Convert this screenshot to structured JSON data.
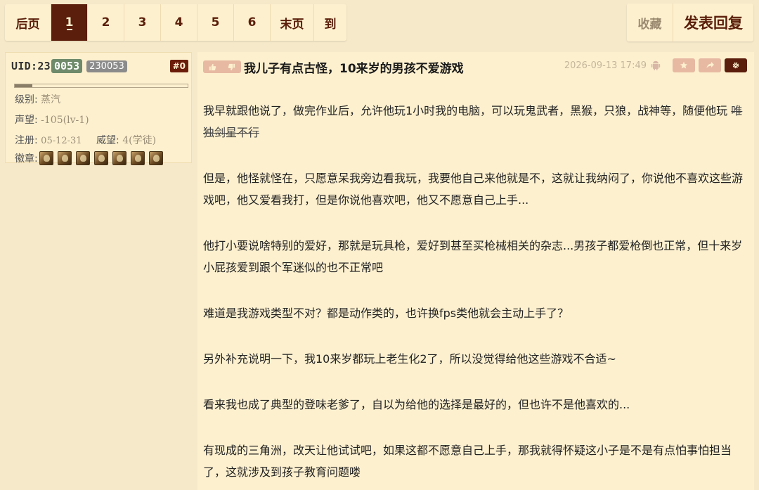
{
  "pager": {
    "items": [
      {
        "label": "后页",
        "width": 66
      },
      {
        "label": "1",
        "width": 52,
        "active": true
      },
      {
        "label": "2",
        "width": 52
      },
      {
        "label": "3",
        "width": 52
      },
      {
        "label": "4",
        "width": 52
      },
      {
        "label": "5",
        "width": 52
      },
      {
        "label": "6",
        "width": 52
      },
      {
        "label": "末页",
        "width": 62
      },
      {
        "label": "到",
        "width": 46
      }
    ]
  },
  "actions": {
    "favorite_label": "收藏",
    "reply_label": "发表回复"
  },
  "user": {
    "uid_prefix": "UID:23",
    "uid_highlight": "0053",
    "uid_badge": "230053",
    "floor": "#0",
    "level_label": "级别:",
    "level_value": "蒸汽",
    "level_progress": 0.1,
    "prestige_label": "声望:",
    "prestige_value": "-105(lv-1)",
    "reg_label": "注册:",
    "reg_value": "05-12-31",
    "power_label": "威望:",
    "power_value": "4(学徒)",
    "medals_label": "徽章:",
    "medal_count": 7
  },
  "post": {
    "title": "我儿子有点古怪，10来岁的男孩不爱游戏",
    "time": "2026-09-13 17:49",
    "p1_text": "我早就跟他说了，做完作业后，允许他玩1小时我的电脑，可以玩鬼武者，黑猴，只狼，战神等，随便他玩 ",
    "p1_strike": "唯独剑星不行",
    "p2": "但是，他怪就怪在，只愿意呆我旁边看我玩，我要他自己来他就是不，这就让我纳闷了，你说他不喜欢这些游戏吧，他又爱看我打，但是你说他喜欢吧，他又不愿意自己上手...",
    "p3": "他打小要说啥特别的爱好，那就是玩具枪，爱好到甚至买枪械相关的杂志...男孩子都爱枪倒也正常，但十来岁小屁孩爱到跟个军迷似的也不正常吧",
    "p4": "难道是我游戏类型不对？都是动作类的，也许换fps类他就会主动上手了？",
    "p5": "另外补充说明一下，我10来岁都玩上老生化2了，所以没觉得给他这些游戏不合适~",
    "p6": "看来我也成了典型的登味老爹了，自以为给他的选择是最好的，但也许不是他喜欢的...",
    "p7": "有现成的三角洲，改天让他试试吧，如果这都不愿意自己上手，那我就得怀疑这小子是不是有点怕事怕担当了，这就涉及到孩子教育问题喽"
  },
  "icons": {
    "thumb_up": "thumbs-up-icon",
    "thumb_down": "thumbs-down-icon",
    "android": "android-icon",
    "star": "star-icon",
    "share": "share-icon",
    "gear": "gear-icon"
  },
  "colors": {
    "page_bg": "#f6e9ca",
    "panel_bg": "#fdf0cf",
    "accent_dark": "#5b1d0c",
    "button_pink": "#e7b9a3",
    "uid_green": "#6e8a6a"
  }
}
